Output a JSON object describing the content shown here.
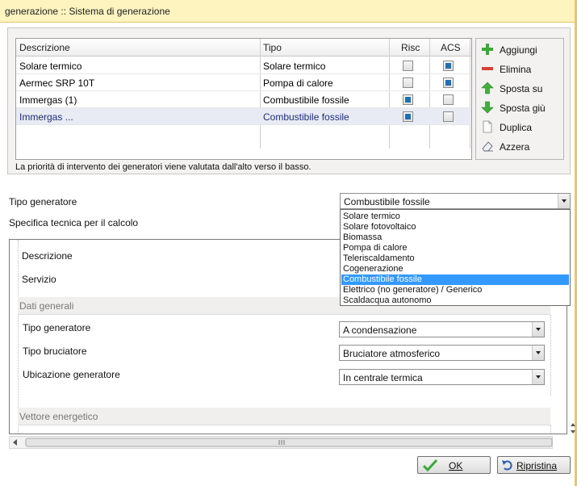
{
  "window": {
    "title": "generazione :: Sistema di generazione"
  },
  "table": {
    "columns": [
      "Descrizione",
      "Tipo",
      "Risc",
      "ACS"
    ],
    "rows": [
      {
        "descrizione": "Solare termico",
        "tipo": "Solare termico",
        "risc": false,
        "acs": true
      },
      {
        "descrizione": "Aermec SRP 10T",
        "tipo": "Pompa di calore",
        "risc": false,
        "acs": true
      },
      {
        "descrizione": "Immergas (1)",
        "tipo": "Combustibile fossile",
        "risc": true,
        "acs": false
      },
      {
        "descrizione": "Immergas ...",
        "tipo": "Combustibile fossile",
        "risc": true,
        "acs": false,
        "selected": true
      }
    ]
  },
  "toolbar": {
    "add": "Aggiungi",
    "delete": "Elimina",
    "move_up": "Sposta su",
    "move_down": "Sposta giù",
    "duplicate": "Duplica",
    "reset": "Azzera"
  },
  "priority_note": "La priorità di intervento dei generatori viene valutata dall'alto verso il basso.",
  "form": {
    "tipo_generatore_label": "Tipo generatore",
    "tipo_generatore_value": "Combustibile fossile",
    "specifica_label": "Specifica tecnica per il calcolo",
    "dropdown_options": [
      "Solare termico",
      "Solare fotovoltaico",
      "Biomassa",
      "Pompa di calore",
      "Teleriscaldamento",
      "Cogenerazione",
      "Combustibile fossile",
      "Elettrico (no generatore) / Generico",
      "Scaldacqua autonomo"
    ],
    "dropdown_highlighted": "Combustibile fossile"
  },
  "properties": {
    "descrizione_label": "Descrizione",
    "servizio_label": "Servizio",
    "dati_generali": "Dati generali",
    "tipo_generatore_label": "Tipo generatore",
    "tipo_generatore_value": "A condensazione",
    "tipo_bruciatore_label": "Tipo bruciatore",
    "tipo_bruciatore_value": "Bruciatore atmosferico",
    "ubicazione_label": "Ubicazione generatore",
    "ubicazione_value": "In centrale termica",
    "vettore_energetico": "Vettore energetico"
  },
  "buttons": {
    "ok": "OK",
    "reset": "Ripristina"
  },
  "colors": {
    "title_bg": "#fdf4bf",
    "highlight": "#3399ff",
    "checkbox_on": "#1f6fb3"
  }
}
